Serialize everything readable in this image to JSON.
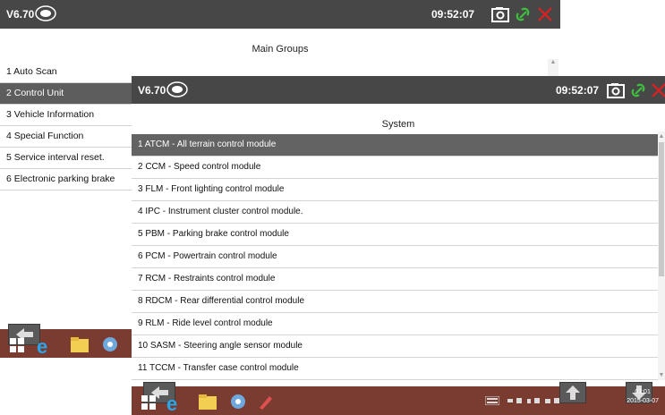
{
  "back_window": {
    "titlebar": {
      "version": "V6.70",
      "time": "09:52:07"
    },
    "header": "Main Groups",
    "items": [
      "1  Auto Scan",
      "2  Control Unit",
      "3  Vehicle Information",
      "4  Special Function",
      "5  Service interval reset.",
      "6  Electronic parking brake"
    ],
    "selected_index": 1
  },
  "front_window": {
    "titlebar": {
      "version": "V6.70",
      "time": "09:52:07"
    },
    "header": "System",
    "items": [
      "1  ATCM - All terrain control module",
      "2  CCM - Speed control module",
      "3  FLM - Front lighting control module",
      "4  IPC - Instrument cluster control module.",
      "5  PBM - Parking brake control module",
      "6  PCM - Powertrain control module",
      "7  RCM - Restraints control module",
      "8  RDCM - Rear differential control module",
      "9  RLM - Ride level control module",
      "10 SASM - Steering angle sensor module",
      "11 TCCM - Transfer case control module"
    ],
    "selected_index": 0,
    "taskbar": {
      "clock_time": "01:01",
      "clock_date": "2015-03-07"
    }
  },
  "icons": [
    "brand-logo-icon",
    "camera-icon",
    "link-icon",
    "close-icon",
    "back-arrow-icon",
    "windows-start-icon",
    "ie-icon",
    "folder-icon",
    "tool-icon",
    "pen-icon",
    "keyboard-icon",
    "up-arrow-icon"
  ],
  "colors": {
    "titlebar": "#474747",
    "selected_row": "#5d5d5d",
    "taskbar": "#7a3c31",
    "link_green": "#3fbf3f",
    "close_red": "#e02020"
  }
}
